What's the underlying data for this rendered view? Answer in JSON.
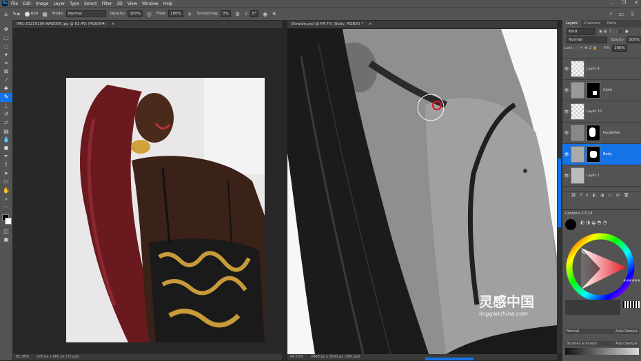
{
  "app": {
    "logo": "Ps"
  },
  "menu": [
    "File",
    "Edit",
    "Image",
    "Layer",
    "Type",
    "Select",
    "Filter",
    "3D",
    "View",
    "Window",
    "Help"
  ],
  "options": {
    "brush_size": "600",
    "mode_label": "Mode:",
    "mode_value": "Normal",
    "opacity_label": "Opacity:",
    "opacity_value": "100%",
    "flow_label": "Flow:",
    "flow_value": "100%",
    "smoothing_label": "Smoothing:",
    "smoothing_value": "0%",
    "angle_value": "0°"
  },
  "doc_left": {
    "tab": "IMG-20210106-WA0006.jpg @ 82.4% (RGB/8#)",
    "zoom": "82.36%",
    "dims": "720 px x 960 px (72 ppi)"
  },
  "doc_right": {
    "tab": "Olawale.psd @ 64.7% (Body, RGB/8) *",
    "zoom": "64.72%",
    "dims": "2400 px x 3000 px (300 ppi)"
  },
  "layers_panel": {
    "tabs": [
      "Layers",
      "Channels",
      "Paths"
    ],
    "kind": "Kind",
    "blend": "Normal",
    "opacity_label": "Opacity:",
    "opacity": "100%",
    "lock_label": "Lock:",
    "fill_label": "Fill:",
    "fill": "100%",
    "layers": [
      {
        "name": "Layer 9",
        "mask": false,
        "selected": false
      },
      {
        "name": "Cloth",
        "mask": true,
        "selected": false
      },
      {
        "name": "Layer 10",
        "mask": false,
        "selected": false
      },
      {
        "name": "Face&Hair",
        "mask": true,
        "selected": false
      },
      {
        "name": "Body",
        "mask": true,
        "selected": true
      },
      {
        "name": "Layer 1",
        "mask": false,
        "selected": false
      }
    ]
  },
  "coolorus": {
    "title": "Coolorus 2.5.16",
    "hex_label": "########",
    "blend_label": "Normal",
    "auto_sample": "Auto Sample",
    "blend2": "Brushes & mixers",
    "auto_sample2": "Auto Sample"
  },
  "watermark": {
    "text": "灵感中国",
    "url": "lingganchina.com"
  },
  "colors": {
    "accent": "#1473e6",
    "ui": "#535353",
    "bg": "#282828"
  }
}
